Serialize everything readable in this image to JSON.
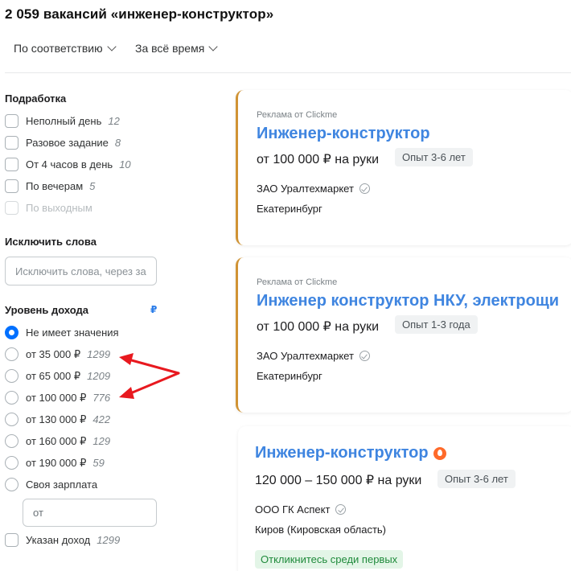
{
  "header": {
    "title": "2 059 вакансий «инженер-конструктор»"
  },
  "sort": {
    "relevance": "По соответствию",
    "period": "За всё время"
  },
  "filters": {
    "part_time": {
      "title": "Подработка",
      "items": [
        {
          "label": "Неполный день",
          "count": "12"
        },
        {
          "label": "Разовое задание",
          "count": "8"
        },
        {
          "label": "От 4 часов в день",
          "count": "10"
        },
        {
          "label": "По вечерам",
          "count": "5"
        },
        {
          "label": "По выходным",
          "count": ""
        }
      ]
    },
    "exclude": {
      "title": "Исключить слова",
      "placeholder": "Исключить слова, через за"
    },
    "income": {
      "title": "Уровень дохода",
      "currency": "₽",
      "options": [
        {
          "label": "Не имеет значения",
          "count": ""
        },
        {
          "label": "от 35 000 ₽",
          "count": "1299"
        },
        {
          "label": "от 65 000 ₽",
          "count": "1209"
        },
        {
          "label": "от 100 000 ₽",
          "count": "776"
        },
        {
          "label": "от 130 000 ₽",
          "count": "422"
        },
        {
          "label": "от 160 000 ₽",
          "count": "129"
        },
        {
          "label": "от 190 000 ₽",
          "count": "59"
        },
        {
          "label": "Своя зарплата",
          "count": ""
        }
      ],
      "custom_placeholder": "от",
      "specified": {
        "label": "Указан доход",
        "count": "1299"
      }
    }
  },
  "vacancies": [
    {
      "ad_label": "Реклама от Clickme",
      "title": "Инженер-конструктор",
      "salary": "от 100 000 ₽ на руки",
      "experience": "Опыт 3-6 лет",
      "company": "ЗАО Уралтехмаркет",
      "city": "Екатеринбург"
    },
    {
      "ad_label": "Реклама от Clickme",
      "title": "Инженер конструктор НКУ, электрощи",
      "salary": "от 100 000 ₽ на руки",
      "experience": "Опыт 1-3 года",
      "company": "ЗАО Уралтехмаркет",
      "city": "Екатеринбург"
    },
    {
      "title": "Инженер-конструктор",
      "salary": "120 000 – 150 000 ₽ на руки",
      "experience": "Опыт 3-6 лет",
      "company": "ООО ГК Аспект",
      "city": "Киров (Кировская область)",
      "badge": "Откликнитесь среди первых"
    }
  ],
  "icons": {
    "chevron": "chevron-down-icon",
    "verified": "verified-check-icon",
    "hot": "fire-icon"
  },
  "colors": {
    "accent": "#0070ff",
    "title_link": "#3f85e0",
    "ad_border": "#d09334",
    "annotation_arrow": "#e8191f"
  }
}
